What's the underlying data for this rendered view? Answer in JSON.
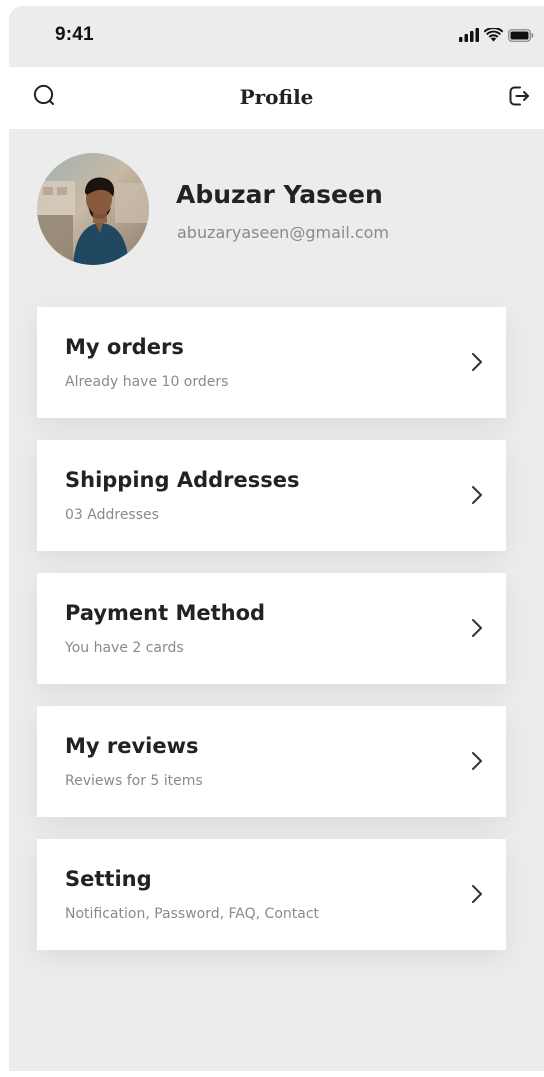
{
  "status_bar": {
    "time": "9:41",
    "signal_icon": "cellular-signal-icon",
    "wifi_icon": "wifi-icon",
    "battery_icon": "battery-icon"
  },
  "nav": {
    "title": "Profile",
    "left_icon": "search-icon",
    "right_icon": "logout-icon"
  },
  "profile": {
    "name": "Abuzar Yaseen",
    "email": "abuzaryaseen@gmail.com"
  },
  "menu": {
    "items": [
      {
        "title": "My orders",
        "subtitle": "Already have 10 orders"
      },
      {
        "title": "Shipping Addresses",
        "subtitle": "03 Addresses"
      },
      {
        "title": "Payment Method",
        "subtitle": "You have 2 cards"
      },
      {
        "title": "My reviews",
        "subtitle": "Reviews for 5 items"
      },
      {
        "title": "Setting",
        "subtitle": "Notification, Password, FAQ, Contact"
      }
    ],
    "chevron_icon": "chevron-right-icon"
  },
  "colors": {
    "screen_background": "#ececec",
    "card_background": "#ffffff",
    "primary_text": "#222222",
    "secondary_text": "#8a8a8a"
  }
}
